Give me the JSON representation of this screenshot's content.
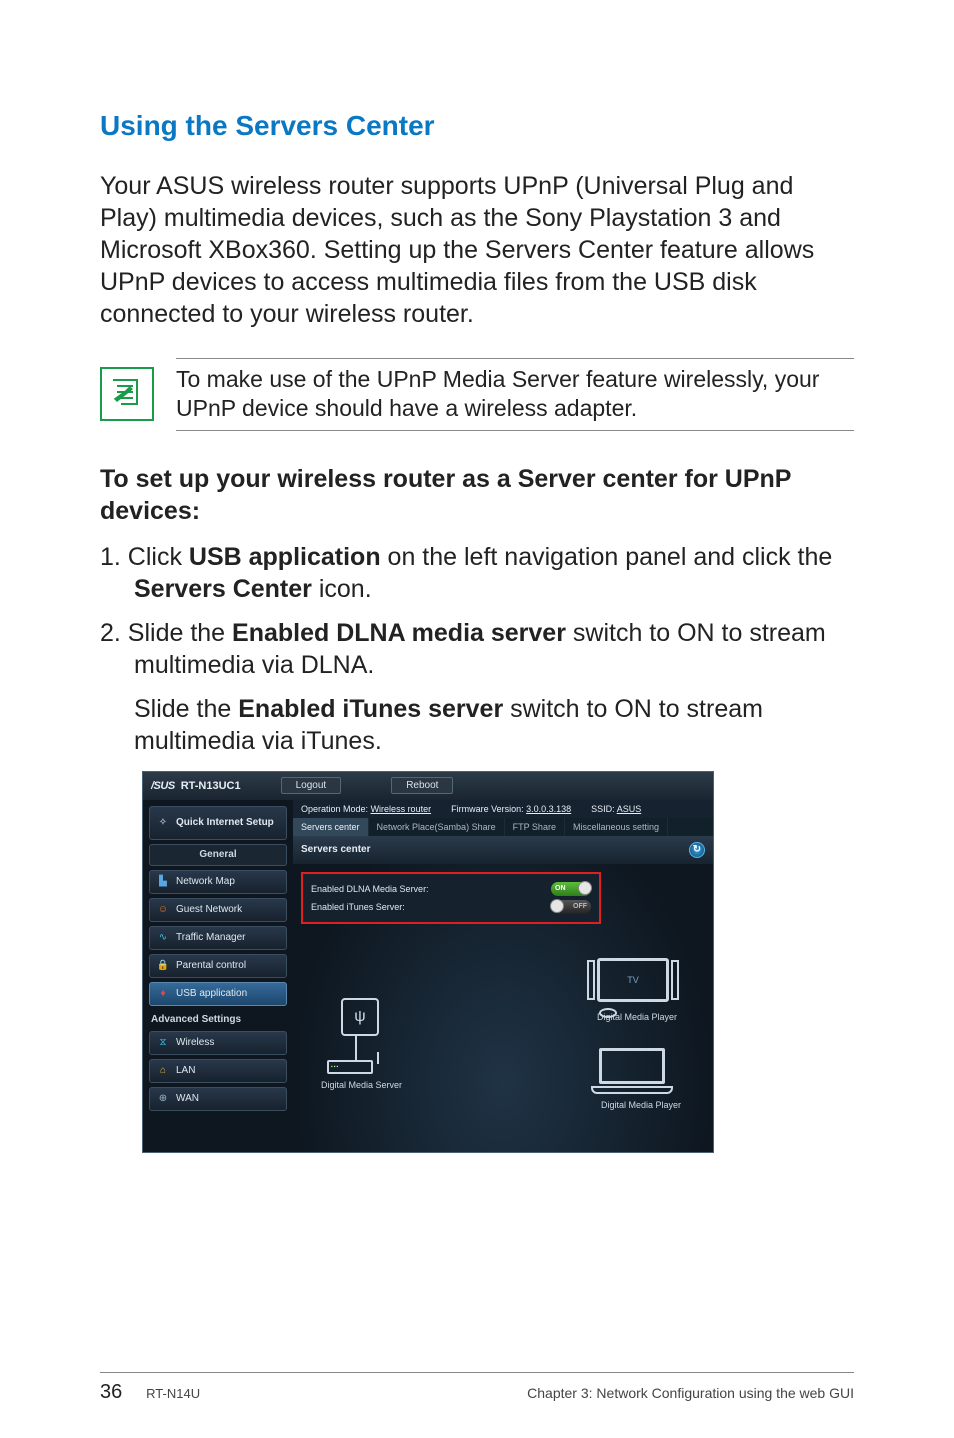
{
  "section_title": "Using the Servers Center",
  "intro": "Your ASUS wireless router supports UPnP (Universal Plug and Play) multimedia devices, such as the Sony Playstation 3 and Microsoft XBox360. Setting up the Servers Center feature allows UPnP devices to access multimedia files from the USB disk connected to your wireless router.",
  "note": "To make use of the UPnP Media Server feature wirelessly, your UPnP device should have a wireless adapter.",
  "subhead": "To set up your wireless router as a Server center for UPnP devices:",
  "steps": {
    "s1_pre": "1.  Click ",
    "s1_b1": "USB application",
    "s1_mid": " on the left navigation panel and click the ",
    "s1_b2": "Servers Center",
    "s1_post": " icon.",
    "s2_pre": "2.  Slide the ",
    "s2_b1": "Enabled DLNA media server",
    "s2_post": " switch to ON to stream multimedia via DLNA.",
    "s2c_pre": "Slide the ",
    "s2c_b1": "Enabled iTunes server",
    "s2c_post": " switch to ON to stream multimedia via iTunes."
  },
  "app": {
    "brand_logo": "/SUS",
    "model": "RT-N13UC1",
    "logout": "Logout",
    "reboot": "Reboot",
    "op_mode_label": "Operation Mode:",
    "op_mode_value": "Wireless router",
    "fw_label": "Firmware Version:",
    "fw_value": "3.0.0.3.138",
    "ssid_label": "SSID:",
    "ssid_value": "ASUS",
    "tabs": [
      "Servers center",
      "Network Place(Samba) Share",
      "FTP Share",
      "Miscellaneous setting"
    ],
    "panel_title": "Servers center",
    "toggle1_label": "Enabled DLNA Media Server:",
    "toggle1_state": "ON",
    "toggle2_label": "Enabled iTunes Server:",
    "toggle2_state": "OFF",
    "sidebar": {
      "qis": "Quick Internet Setup",
      "general": "General",
      "items": [
        "Network Map",
        "Guest Network",
        "Traffic Manager",
        "Parental control",
        "USB application"
      ],
      "adv": "Advanced Settings",
      "adv_items": [
        "Wireless",
        "LAN",
        "WAN"
      ]
    },
    "diagram": {
      "dms": "Digital Media Server",
      "tv": "TV",
      "dmp": "Digital Media Player"
    }
  },
  "footer": {
    "page": "36",
    "model": "RT-N14U",
    "chapter": "Chapter 3: Network Configuration using the web GUI"
  }
}
